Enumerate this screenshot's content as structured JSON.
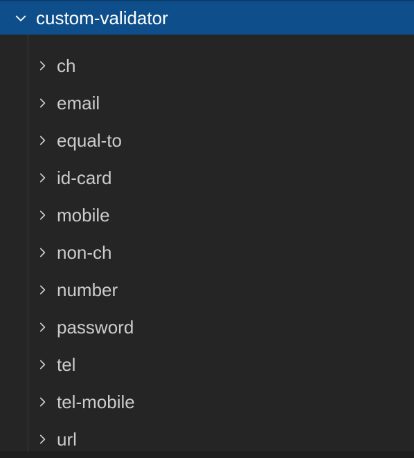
{
  "header": {
    "title": "custom-validator"
  },
  "items": [
    {
      "label": "ch"
    },
    {
      "label": "email"
    },
    {
      "label": "equal-to"
    },
    {
      "label": "id-card"
    },
    {
      "label": "mobile"
    },
    {
      "label": "non-ch"
    },
    {
      "label": "number"
    },
    {
      "label": "password"
    },
    {
      "label": "tel"
    },
    {
      "label": "tel-mobile"
    },
    {
      "label": "url"
    }
  ]
}
